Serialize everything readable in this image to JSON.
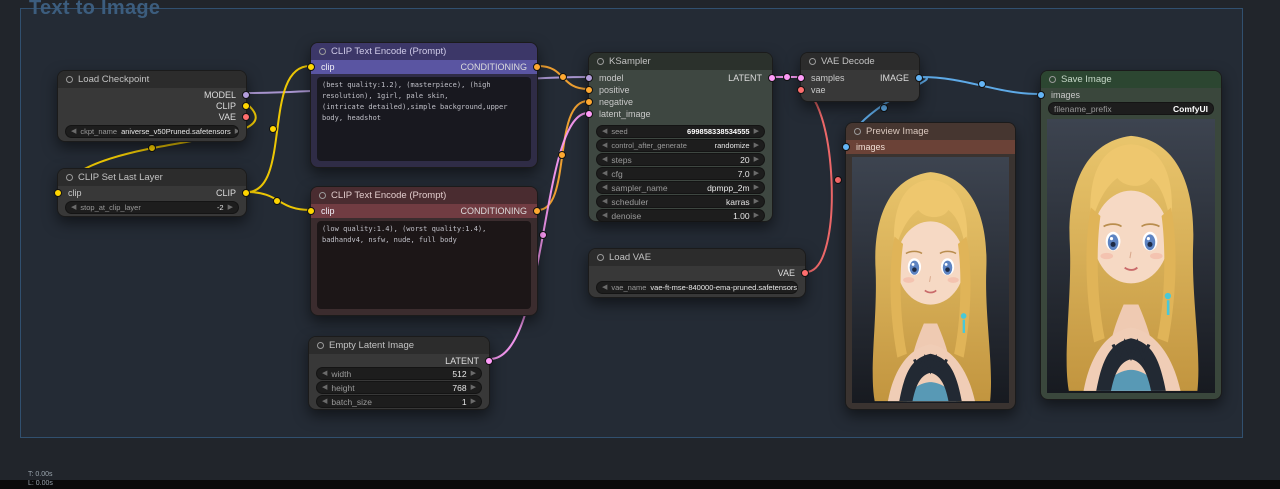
{
  "app": {
    "group_title": "Text to Image",
    "stats": {
      "line1": "T: 0.00s",
      "line2": "L: 0.00s"
    }
  },
  "icons": {
    "arrow_left": "◀",
    "arrow_right": "▶"
  },
  "link_colors": {
    "model": "#B39DDB",
    "clip": "#FFD500",
    "vae": "#FF6E6E",
    "conditioning": "#FFA931",
    "latent": "#FF9CF9",
    "image": "#64B5F6"
  },
  "nodes": {
    "load_checkpoint": {
      "title": "Load Checkpoint",
      "outputs": {
        "model": "MODEL",
        "clip": "CLIP",
        "vae": "VAE"
      },
      "widgets": {
        "ckpt_name": {
          "label": "ckpt_name",
          "value": "aniverse_v50Pruned.safetensors"
        }
      }
    },
    "clip_set_last_layer": {
      "title": "CLIP Set Last Layer",
      "inputs": {
        "clip": "clip"
      },
      "outputs": {
        "clip": "CLIP"
      },
      "widgets": {
        "stop_at_clip_layer": {
          "label": "stop_at_clip_layer",
          "value": "-2"
        }
      }
    },
    "clip_text_encode_positive": {
      "title": "CLIP Text Encode (Prompt)",
      "inputs": {
        "clip": "clip"
      },
      "outputs": {
        "conditioning": "CONDITIONING"
      },
      "prompt": "(best quality:1.2), (masterpiece), (high resolution), 1girl, pale skin,\n(intricate detailed),simple background,upper body, headshot"
    },
    "clip_text_encode_negative": {
      "title": "CLIP Text Encode (Prompt)",
      "inputs": {
        "clip": "clip"
      },
      "outputs": {
        "conditioning": "CONDITIONING"
      },
      "prompt": "(low quality:1.4), (worst quality:1.4), badhandv4, nsfw, nude, full body"
    },
    "empty_latent_image": {
      "title": "Empty Latent Image",
      "outputs": {
        "latent": "LATENT"
      },
      "widgets": {
        "width": {
          "label": "width",
          "value": "512"
        },
        "height": {
          "label": "height",
          "value": "768"
        },
        "batch_size": {
          "label": "batch_size",
          "value": "1"
        }
      }
    },
    "ksampler": {
      "title": "KSampler",
      "inputs": {
        "model": "model",
        "positive": "positive",
        "negative": "negative",
        "latent_image": "latent_image"
      },
      "outputs": {
        "latent": "LATENT"
      },
      "widgets": {
        "seed": {
          "label": "seed",
          "value": "699858338534555"
        },
        "control_after_generate": {
          "label": "control_after_generate",
          "value": "randomize"
        },
        "steps": {
          "label": "steps",
          "value": "20"
        },
        "cfg": {
          "label": "cfg",
          "value": "7.0"
        },
        "sampler_name": {
          "label": "sampler_name",
          "value": "dpmpp_2m"
        },
        "scheduler": {
          "label": "scheduler",
          "value": "karras"
        },
        "denoise": {
          "label": "denoise",
          "value": "1.00"
        }
      }
    },
    "load_vae": {
      "title": "Load VAE",
      "outputs": {
        "vae": "VAE"
      },
      "widgets": {
        "vae_name": {
          "label": "vae_name",
          "value": "vae-ft-mse-840000-ema-pruned.safetensors"
        }
      }
    },
    "vae_decode": {
      "title": "VAE Decode",
      "inputs": {
        "samples": "samples",
        "vae": "vae"
      },
      "outputs": {
        "image": "IMAGE"
      }
    },
    "preview_image": {
      "title": "Preview Image",
      "inputs": {
        "images": "images"
      }
    },
    "save_image": {
      "title": "Save Image",
      "inputs": {
        "images": "images"
      },
      "widgets": {
        "filename_prefix": {
          "label": "filename_prefix",
          "value": "ComfyUI"
        }
      }
    }
  }
}
